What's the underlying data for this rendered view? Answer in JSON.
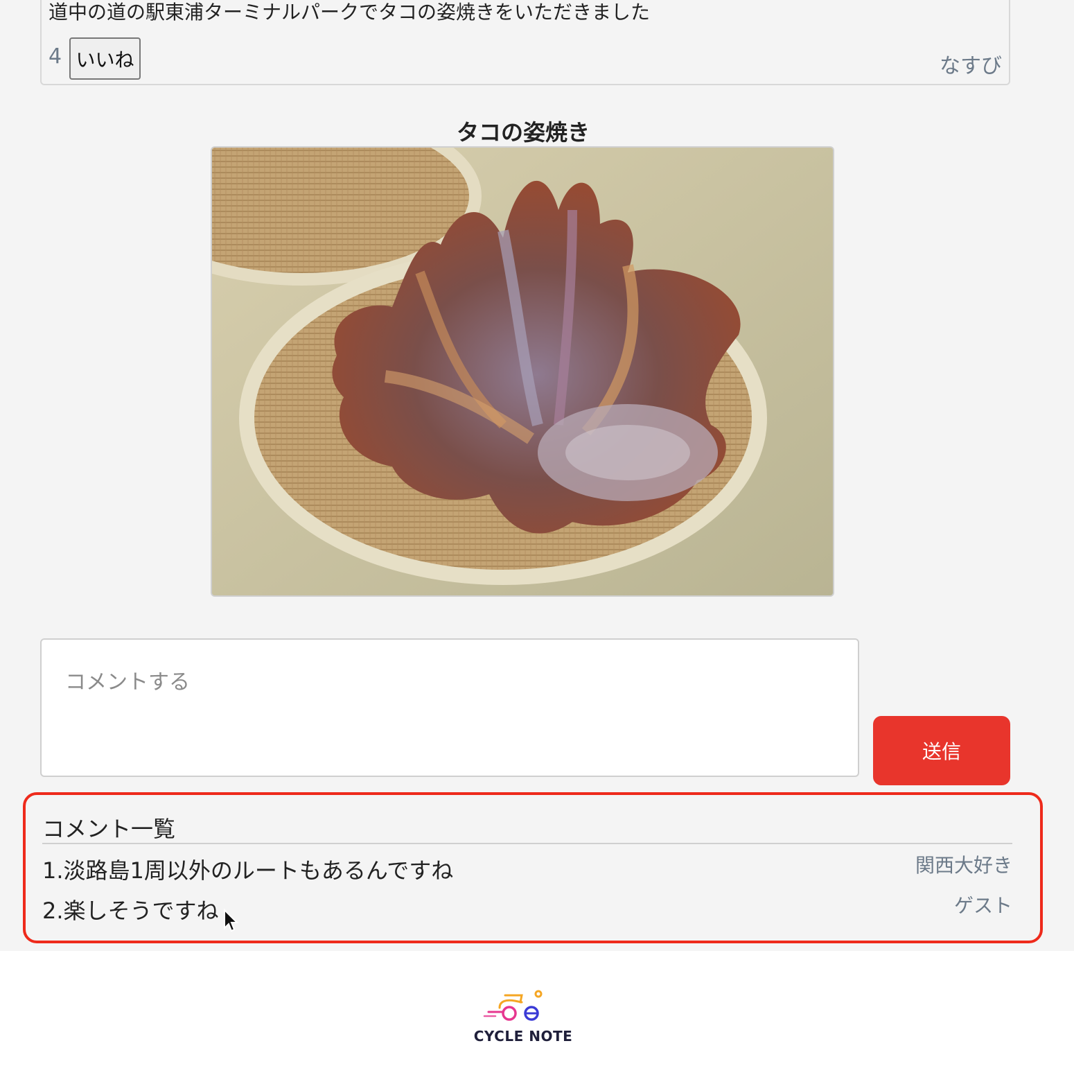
{
  "post": {
    "text": "道中の道の駅東浦ターミナルパークでタコの姿焼きをいただきました",
    "like_count": "4",
    "like_label": "いいね",
    "author": "なすび"
  },
  "photo": {
    "title": "タコの姿焼き"
  },
  "comment_form": {
    "placeholder": "コメントする",
    "send_label": "送信"
  },
  "comments": {
    "heading": "コメント一覧",
    "items": [
      {
        "text": "1.淡路島1周以外のルートもあるんですね",
        "author": "関西大好き"
      },
      {
        "text": "2.楽しそうですね",
        "author": "ゲスト"
      }
    ]
  },
  "footer": {
    "logo_text": "CYCLE NOTE"
  },
  "colors": {
    "accent": "#e8352c",
    "highlight": "#ee2a1b",
    "muted_text": "#6c7a89"
  }
}
